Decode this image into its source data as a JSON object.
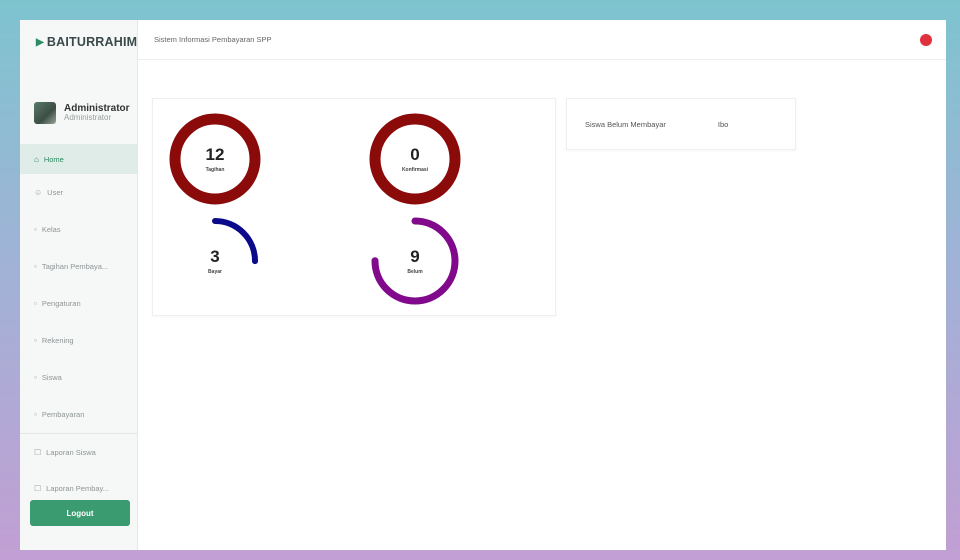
{
  "brand": {
    "name": "BAITURRAHIM",
    "accent": "#2e8a63"
  },
  "profile": {
    "name": "Administrator",
    "role": "Administrator"
  },
  "nav": [
    {
      "icon": "home-icon",
      "label": "Home",
      "active": true
    },
    {
      "icon": "user-icon",
      "label": "User"
    },
    {
      "icon": "class-icon",
      "label": "Kelas"
    },
    {
      "icon": "bill-icon",
      "label": "Tagihan Pembaya..."
    },
    {
      "icon": "settings-icon",
      "label": "Pengaturan"
    },
    {
      "icon": "student-icon",
      "label": "Rekening"
    },
    {
      "icon": "student-icon",
      "label": "Siswa"
    },
    {
      "icon": "payment-icon",
      "label": "Pembayaran"
    },
    {
      "icon": "report-icon",
      "label": "Laporan Siswa"
    },
    {
      "icon": "report-icon",
      "label": "Laporan Pembay..."
    }
  ],
  "logout_label": "Logout",
  "topbar": {
    "title": "Sistem Informasi Pembayaran SPP"
  },
  "stats": [
    {
      "value": "12",
      "label": "Tagihan",
      "color": "#8b0a0a",
      "fraction": 1.0
    },
    {
      "value": "0",
      "label": "Konfirmasi",
      "color": "#8b0a0a",
      "fraction": 1.0
    },
    {
      "value": "3",
      "label": "Bayar",
      "color": "#0a0a8b",
      "fraction": 0.25
    },
    {
      "value": "9",
      "label": "Belum",
      "color": "#800a8b",
      "fraction": 0.75
    }
  ],
  "info": {
    "label": "Siswa Belum Membayar",
    "value": "Ibo"
  }
}
